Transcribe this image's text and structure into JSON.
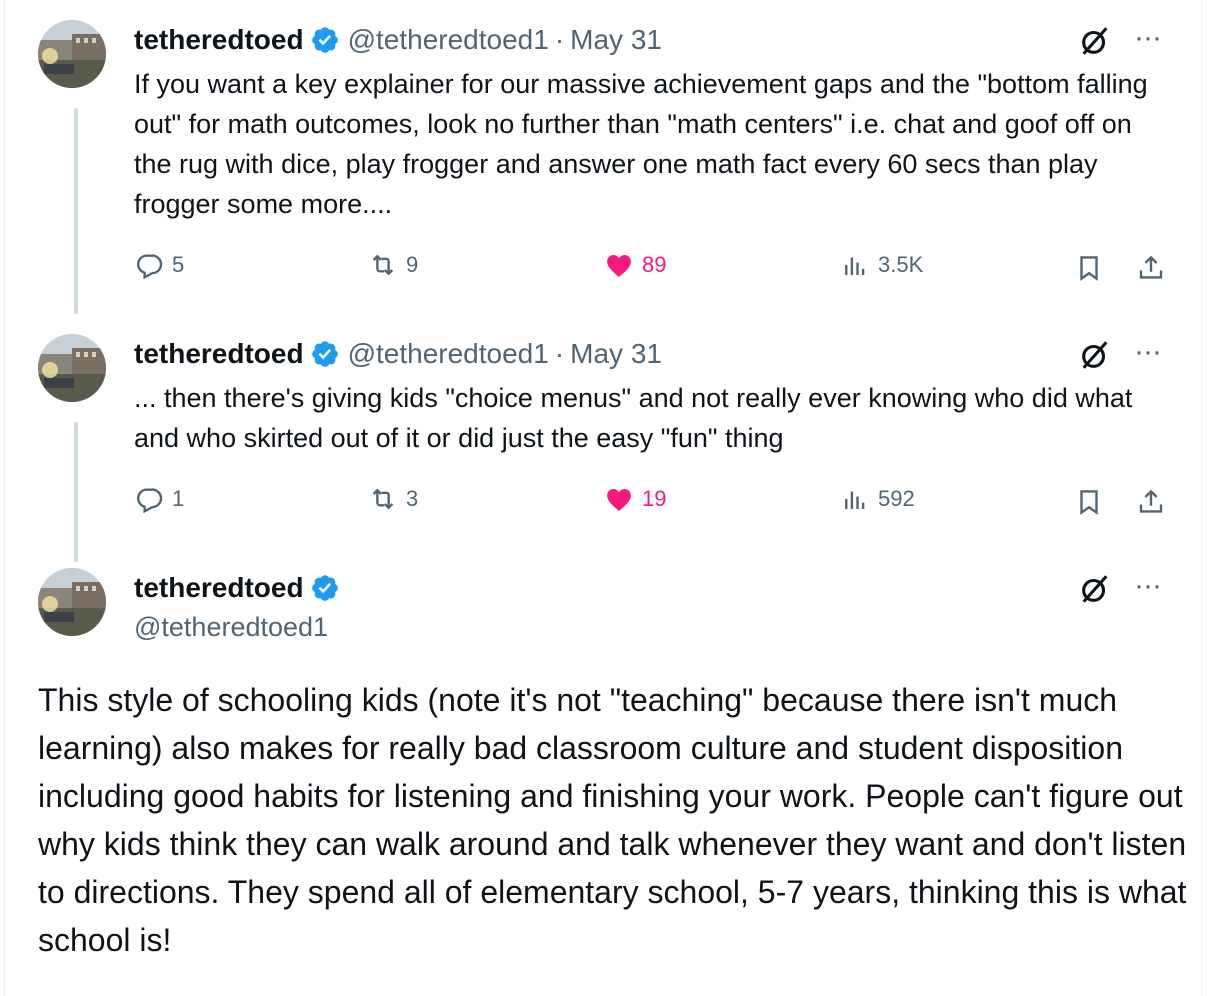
{
  "tweets": [
    {
      "name": "tetheredtoed",
      "handle": "@tetheredtoed1",
      "separator": "·",
      "date": "May 31",
      "text": "If you want a key explainer for our massive achievement gaps and the \"bottom falling out\" for math outcomes, look no further than \"math centers\" i.e. chat and goof off on the rug with dice, play frogger and answer one math fact every 60 secs than play frogger some more....",
      "replies": "5",
      "reposts": "9",
      "likes": "89",
      "views": "3.5K"
    },
    {
      "name": "tetheredtoed",
      "handle": "@tetheredtoed1",
      "separator": "·",
      "date": "May 31",
      "text": "... then there's giving kids \"choice menus\" and not really ever knowing who did what and who skirted out of it or did just the easy \"fun\" thing",
      "replies": "1",
      "reposts": "3",
      "likes": "19",
      "views": "592"
    }
  ],
  "main_tweet": {
    "name": "tetheredtoed",
    "handle": "@tetheredtoed1",
    "text": "This style of schooling kids (note it's not \"teaching\" because there isn't much learning) also makes for really bad classroom culture and student disposition including good habits for listening and finishing your work. People can't figure out why kids think they can walk around and talk whenever they want and don't listen to directions. They spend all of elementary school, 5-7 years, thinking this is what school is!"
  },
  "more_label": "···",
  "icons": {
    "verified": "verified-badge-icon",
    "grok": "grok-icon",
    "reply": "reply-icon",
    "repost": "repost-icon",
    "like": "heart-icon",
    "views": "views-icon",
    "bookmark": "bookmark-icon",
    "share": "share-icon"
  },
  "colors": {
    "verified": "#1d9bf0",
    "like": "#f91880",
    "muted": "#536471",
    "text": "#0f1419",
    "thread_line": "#cfd9de"
  }
}
